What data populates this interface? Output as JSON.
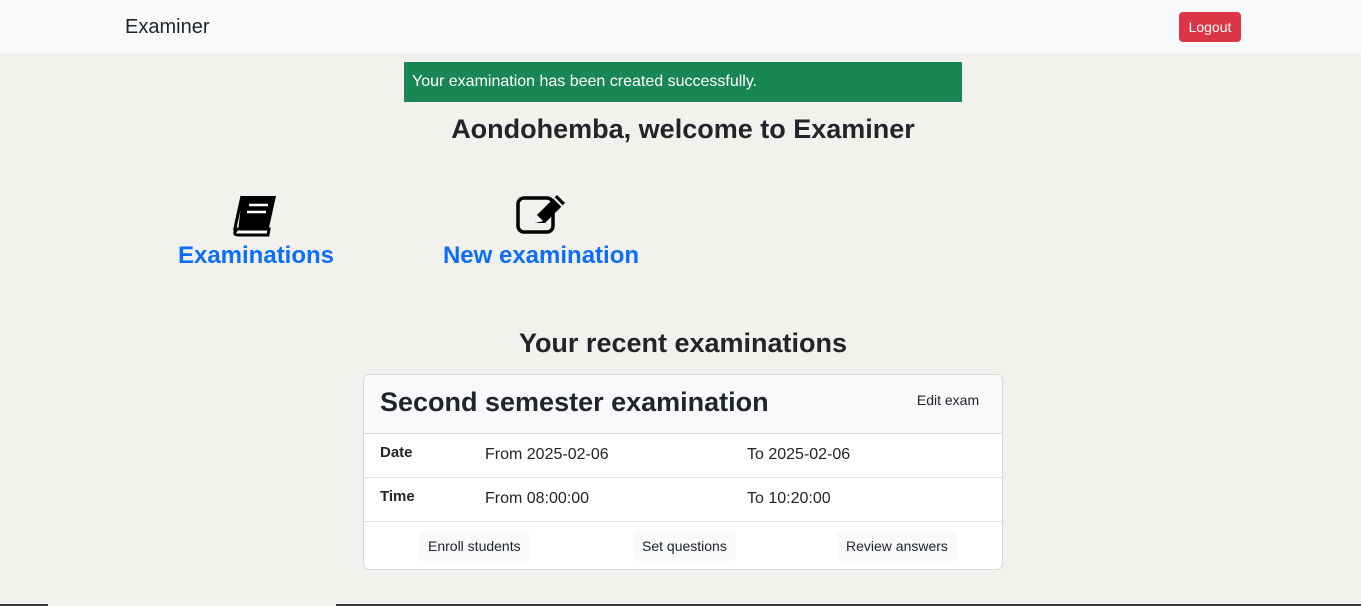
{
  "navbar": {
    "brand": "Examiner",
    "logout_label": "Logout",
    "logout_color": "#dc3545"
  },
  "alert": {
    "text": "Your examination has been created successfully.",
    "color": "#198754"
  },
  "welcome": "Aondohemba, welcome to Examiner",
  "links": [
    {
      "label": "Examinations",
      "icon": "book-icon"
    },
    {
      "label": "New examination",
      "icon": "edit-icon"
    }
  ],
  "recent_title": "Your recent examinations",
  "exam": {
    "title": "Second semester examination",
    "edit_label": "Edit exam",
    "date": {
      "label": "Date",
      "from": "From 2025-02-06",
      "to": "To 2025-02-06"
    },
    "time": {
      "label": "Time",
      "from": "From 08:00:00",
      "to": "To 10:20:00"
    },
    "actions": {
      "enroll": "Enroll students",
      "questions": "Set questions",
      "review": "Review answers"
    }
  }
}
